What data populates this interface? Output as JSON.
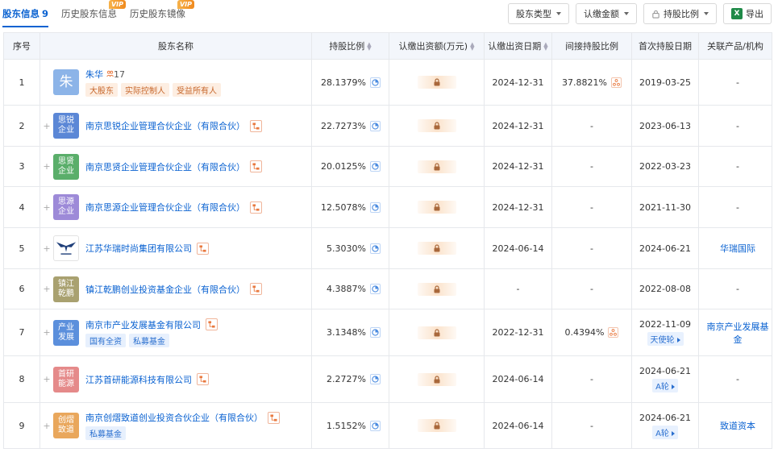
{
  "tabs": [
    {
      "label": "股东信息",
      "count": "9",
      "active": true,
      "vip": ""
    },
    {
      "label": "历史股东信息",
      "count": "",
      "active": false,
      "vip": "VIP"
    },
    {
      "label": "历史股东镜像",
      "count": "",
      "active": false,
      "vip": "VIP"
    }
  ],
  "toolbar": {
    "shareholder_type": "股东类型",
    "subscribed_amount": "认缴金额",
    "holding_ratio": "持股比例",
    "export": "导出",
    "excel_glyph": "X"
  },
  "columns": [
    "序号",
    "股东名称",
    "持股比例",
    "认缴出资额(万元)",
    "认缴出资日期",
    "间接持股比例",
    "首次持股日期",
    "关联产品/机构"
  ],
  "rows": [
    {
      "index": "1",
      "logo_text": "朱",
      "logo_color": "#8cb4e8",
      "logo_style": "big",
      "name": "朱华",
      "person_count": "17",
      "tags": [
        {
          "text": "大股东",
          "style": "orange"
        },
        {
          "text": "实际控制人",
          "style": "orange"
        },
        {
          "text": "受益所有人",
          "style": "orange"
        }
      ],
      "ratio": "28.1379%",
      "sub_date": "2024-12-31",
      "indirect": "37.8821%",
      "first_date": "2019-03-25",
      "round": "",
      "product": "-"
    },
    {
      "index": "2",
      "logo_text": "思锐企业",
      "logo_color": "#5b87d6",
      "name": "南京思锐企业管理合伙企业（有限合伙）",
      "tags": [],
      "ratio": "22.7273%",
      "sub_date": "2024-12-31",
      "indirect": "-",
      "first_date": "2023-06-13",
      "round": "",
      "product": "-"
    },
    {
      "index": "3",
      "logo_text": "思贤企业",
      "logo_color": "#5aae6a",
      "name": "南京思贤企业管理合伙企业（有限合伙）",
      "tags": [],
      "ratio": "20.0125%",
      "sub_date": "2024-12-31",
      "indirect": "-",
      "first_date": "2022-03-23",
      "round": "",
      "product": "-"
    },
    {
      "index": "4",
      "logo_text": "思源企业",
      "logo_color": "#9d8ad8",
      "name": "南京思源企业管理合伙企业（有限合伙）",
      "tags": [],
      "ratio": "12.5078%",
      "sub_date": "2024-12-31",
      "indirect": "-",
      "first_date": "2021-11-30",
      "round": "",
      "product": "-"
    },
    {
      "index": "5",
      "logo_text": "",
      "logo_color": "#ffffff",
      "logo_style": "eagle",
      "name": "江苏华瑞时尚集团有限公司",
      "tags": [],
      "ratio": "5.3030%",
      "sub_date": "2024-06-14",
      "indirect": "-",
      "first_date": "2024-06-21",
      "round": "",
      "product": "华瑞国际"
    },
    {
      "index": "6",
      "logo_text": "镇江乾鹏",
      "logo_color": "#a9a170",
      "name": "镇江乾鹏创业投资基金企业（有限合伙）",
      "tags": [],
      "ratio": "4.3887%",
      "sub_date": "-",
      "indirect": "-",
      "first_date": "2022-08-08",
      "round": "",
      "product": "-"
    },
    {
      "index": "7",
      "logo_text": "产业发展",
      "logo_color": "#5b8fdc",
      "name": "南京市产业发展基金有限公司",
      "tags": [
        {
          "text": "国有全资",
          "style": "blue"
        },
        {
          "text": "私募基金",
          "style": "blue"
        }
      ],
      "ratio": "3.1348%",
      "sub_date": "2022-12-31",
      "indirect": "0.4394%",
      "first_date": "2022-11-09",
      "round": "天使轮",
      "product": "南京产业发展基金"
    },
    {
      "index": "8",
      "logo_text": "首研能源",
      "logo_color": "#e58a8a",
      "name": "江苏首研能源科技有限公司",
      "tags": [],
      "ratio": "2.2727%",
      "sub_date": "2024-06-14",
      "indirect": "-",
      "first_date": "2024-06-21",
      "round": "A轮",
      "product": "-"
    },
    {
      "index": "9",
      "logo_text": "创熠致道",
      "logo_color": "#e9a75c",
      "name": "南京创熠致道创业投资合伙企业（有限合伙）",
      "tags": [
        {
          "text": "私募基金",
          "style": "blue"
        }
      ],
      "ratio": "1.5152%",
      "sub_date": "2024-06-14",
      "indirect": "-",
      "first_date": "2024-06-21",
      "round": "A轮",
      "product": "致道资本"
    }
  ]
}
